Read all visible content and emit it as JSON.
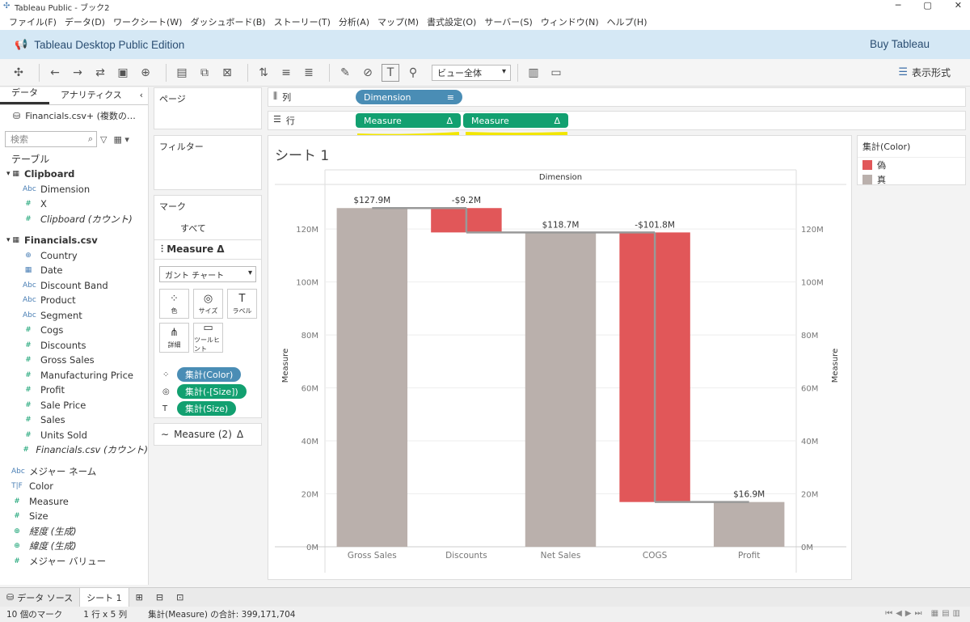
{
  "window": {
    "title": "Tableau Public - ブック2"
  },
  "menu": [
    "ファイル(F)",
    "データ(D)",
    "ワークシート(W)",
    "ダッシュボード(B)",
    "ストーリー(T)",
    "分析(A)",
    "マップ(M)",
    "書式設定(O)",
    "サーバー(S)",
    "ウィンドウ(N)",
    "ヘルプ(H)"
  ],
  "banner": {
    "edition": "Tableau Desktop Public Edition",
    "buy": "Buy Tableau"
  },
  "toolbar": {
    "fit_select": "ビュー全体",
    "show_me": "表示形式"
  },
  "data_pane": {
    "tab_data": "データ",
    "tab_analytics": "アナリティクス",
    "source": "Financials.csv+ (複数の…",
    "search_placeholder": "検索",
    "tables_label": "テーブル",
    "clipboard": {
      "name": "Clipboard",
      "fields": [
        "Dimension",
        "X",
        "Clipboard (カウント)"
      ]
    },
    "financials": {
      "name": "Financials.csv",
      "dims": [
        "Country",
        "Date",
        "Discount Band",
        "Product",
        "Segment"
      ],
      "measures": [
        "Cogs",
        "Discounts",
        "Gross Sales",
        "Manufacturing Price",
        "Profit",
        "Sale Price",
        "Sales",
        "Units Sold",
        "Financials.csv (カウント)"
      ]
    },
    "extra": [
      "メジャー ネーム",
      "Color",
      "Measure",
      "Size",
      "経度 (生成)",
      "緯度 (生成)",
      "メジャー バリュー"
    ]
  },
  "cards": {
    "pages": "ページ",
    "filters": "フィルター",
    "marks": "マーク",
    "marks_all": "すべて",
    "marks_measure": "Measure",
    "mark_type": "ガント チャート",
    "mark_buttons": [
      "色",
      "サイズ",
      "ラベル",
      "詳細",
      "ツールヒント"
    ],
    "mark_pills": [
      "集計(Color)",
      "集計(-[Size])",
      "集計(Size)"
    ],
    "marks_measure2": "Measure (2)"
  },
  "shelves": {
    "columns_label": "列",
    "rows_label": "行",
    "columns_pill": "Dimension",
    "rows_pills": [
      "Measure",
      "Measure"
    ]
  },
  "sheet_title": "シート 1",
  "legend": {
    "title": "集計(Color)",
    "items": [
      {
        "label": "偽",
        "color": "#e15759"
      },
      {
        "label": "真",
        "color": "#bab0ac"
      }
    ]
  },
  "chart_data": {
    "type": "bar",
    "title": "Dimension",
    "ylabel": "Measure",
    "categories": [
      "Gross Sales",
      "Discounts",
      "Net Sales",
      "COGS",
      "Profit"
    ],
    "labels": [
      "$127.9M",
      "-$9.2M",
      "$118.7M",
      "-$101.8M",
      "$16.9M"
    ],
    "bar_bottom": [
      0,
      118.7,
      0,
      16.9,
      0
    ],
    "bar_top": [
      127.9,
      127.9,
      118.7,
      118.7,
      16.9
    ],
    "colors": [
      "#bab0ac",
      "#e15759",
      "#bab0ac",
      "#e15759",
      "#bab0ac"
    ],
    "yticks": [
      "0M",
      "20M",
      "40M",
      "60M",
      "80M",
      "100M",
      "120M"
    ],
    "ylim": [
      0,
      135
    ]
  },
  "sheet_tabs": {
    "data_source": "データ ソース",
    "sheet": "シート 1"
  },
  "status": {
    "marks": "10 個のマーク",
    "rowscols": "1 行 x 5 列",
    "sum": "集計(Measure) の合計: 399,171,704"
  }
}
